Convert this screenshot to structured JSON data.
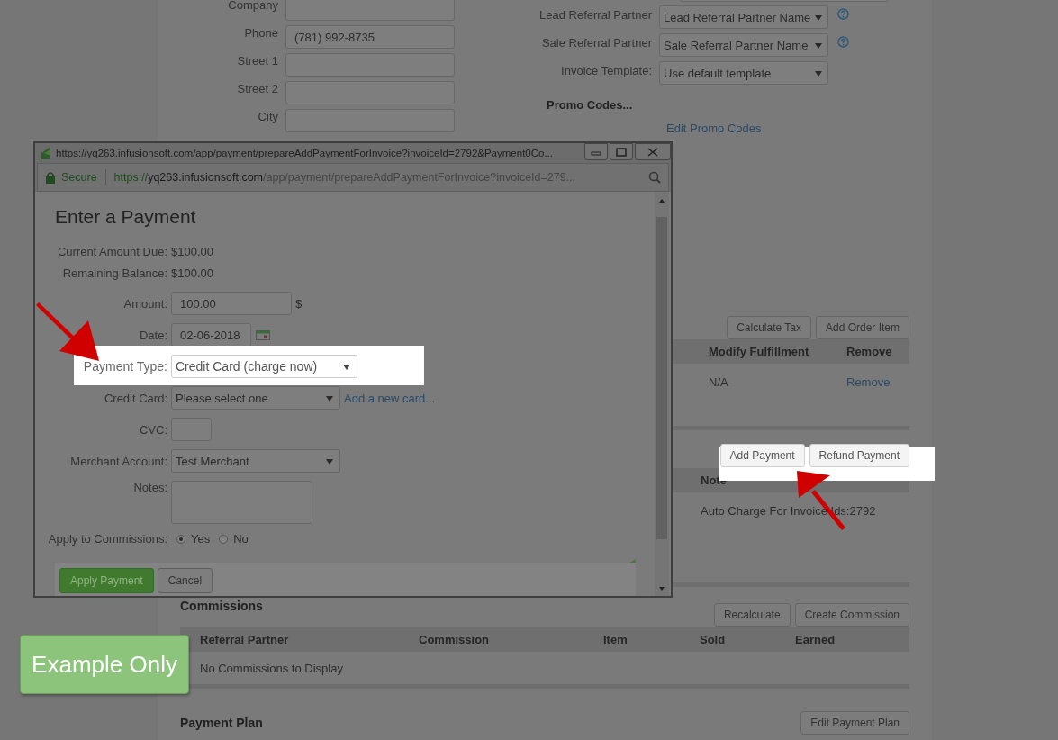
{
  "background_page": {
    "contact_fields": [
      {
        "label": "Company"
      },
      {
        "label": "Phone",
        "value": "(781) 992-8735"
      },
      {
        "label": "Street 1"
      },
      {
        "label": "Street 2"
      },
      {
        "label": "City"
      }
    ],
    "referral_fields": [
      {
        "label": "Lead Referral Partner",
        "value": "Lead Referral Partner Name",
        "help": true
      },
      {
        "label": "Sale Referral Partner",
        "value": "Sale Referral Partner Name",
        "help": true
      },
      {
        "label": "Invoice Template:",
        "value": "Use default template",
        "help": false
      }
    ],
    "promo_codes": {
      "title": "Promo Codes...",
      "link": "Edit Promo Codes"
    },
    "order_items": {
      "buttons": [
        "Calculate Tax",
        "Add Order Item"
      ],
      "columns": [
        "Modify Fulfillment",
        "Remove"
      ],
      "rows": [
        {
          "fulfillment": "N/A",
          "remove": "Remove"
        }
      ]
    },
    "payments": {
      "highlighted": true,
      "buttons": [
        "Add Payment",
        "Refund Payment"
      ],
      "columns": [
        "Note"
      ],
      "rows": [
        {
          "note": "Auto Charge For Invoice Ids:2792"
        }
      ]
    },
    "commissions": {
      "title": "Commissions",
      "buttons": [
        "Recalculate",
        "Create Commission"
      ],
      "columns": [
        "Referral Partner",
        "Commission",
        "Item",
        "Sold",
        "Earned"
      ],
      "empty_text": "No Commissions to Display"
    },
    "payment_plan": {
      "title": "Payment Plan",
      "button": "Edit Payment Plan"
    }
  },
  "popup": {
    "title": "https://yq263.infusionsoft.com/app/payment/prepareAddPaymentForInvoice?invoiceId=2792&Payment0Co...",
    "address": {
      "secure_label": "Secure",
      "scheme": "https://",
      "host": "yq263.infusionsoft.com",
      "path": "/app/payment/prepareAddPaymentForInvoice?invoiceId=279..."
    },
    "heading": "Enter a Payment",
    "summary": [
      {
        "label": "Current Amount Due:",
        "value": "$100.00"
      },
      {
        "label": "Remaining Balance:",
        "value": "$100.00"
      }
    ],
    "fields": [
      {
        "kind": "money",
        "label": "Amount:",
        "value": "100.00",
        "suffix": "$"
      },
      {
        "kind": "date",
        "label": "Date:",
        "value": "02-06-2018"
      },
      {
        "kind": "select",
        "label": "Payment Type:",
        "value": "Credit Card (charge now)",
        "highlighted": true
      },
      {
        "kind": "select",
        "label": "Credit Card:",
        "value": "Please select one",
        "link": "Add a new card...",
        "highlighted": false
      },
      {
        "kind": "short",
        "label": "CVC:"
      },
      {
        "kind": "select",
        "label": "Merchant Account:",
        "value": "Test Merchant",
        "highlighted": false
      },
      {
        "kind": "textarea",
        "label": "Notes:"
      },
      {
        "kind": "radio",
        "label": "Apply to Commissions:",
        "options": [
          {
            "label": "Yes",
            "selected": true
          },
          {
            "label": "No",
            "selected": false
          }
        ]
      }
    ],
    "buttons": [
      "Apply Payment",
      "Cancel"
    ]
  },
  "badge": "Example Only"
}
